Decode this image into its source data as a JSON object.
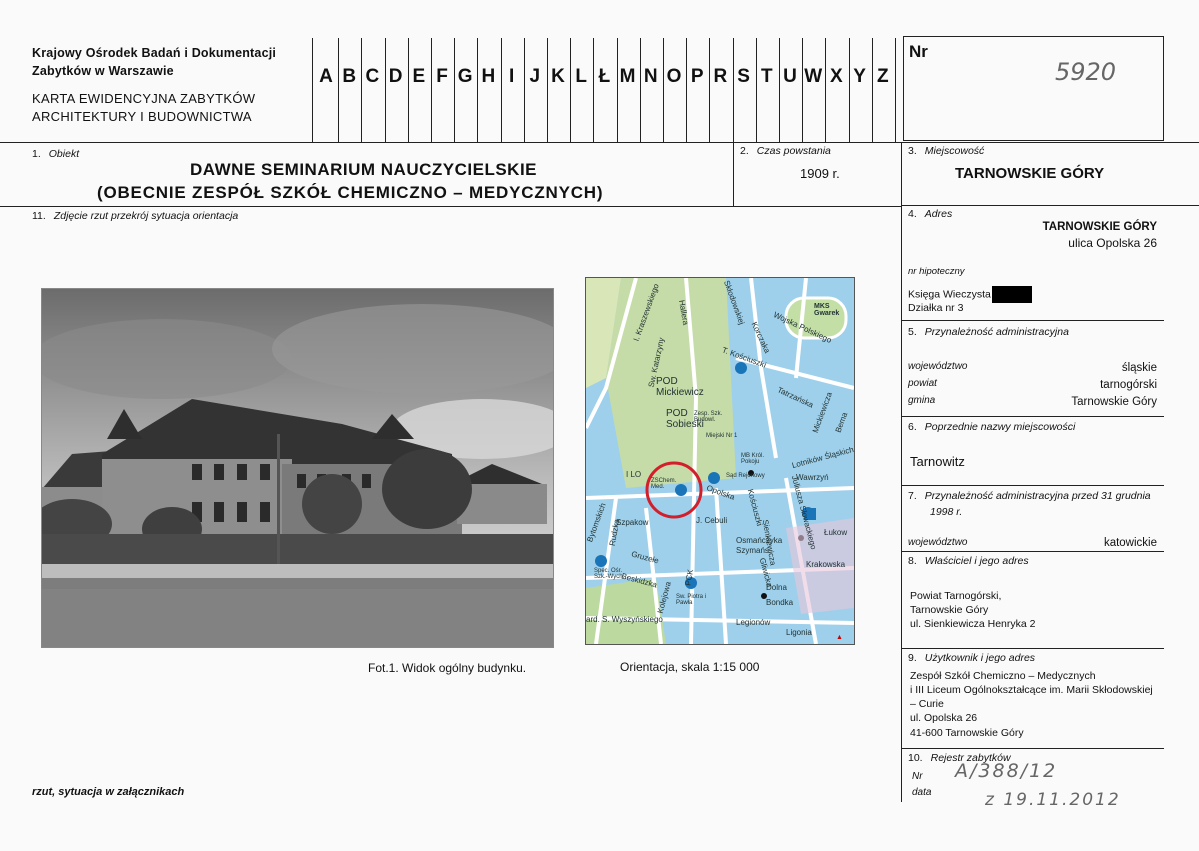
{
  "header": {
    "org_line1": "Krajowy Ośrodek Badań i Dokumentacji",
    "org_line2": "Zabytków w Warszawie",
    "card_line1": "KARTA EWIDENCYJNA ZABYTKÓW",
    "card_line2": "ARCHITEKTURY I BUDOWNICTWA",
    "letters": [
      "A",
      "B",
      "C",
      "D",
      "E",
      "F",
      "G",
      "H",
      "I",
      "J",
      "K",
      "L",
      "Ł",
      "M",
      "N",
      "O",
      "P",
      "R",
      "S",
      "T",
      "U",
      "W",
      "X",
      "Y",
      "Z"
    ],
    "nr_label": "Nr",
    "nr_value": "5920"
  },
  "object": {
    "label_num": "1.",
    "label": "Obiekt",
    "title1": "DAWNE SEMINARIUM NAUCZYCIELSKIE",
    "title2": "(OBECNIE ZESPÓŁ SZKÓŁ CHEMICZNO – MEDYCZNYCH)"
  },
  "period": {
    "label_num": "2.",
    "label": "Czas powstania",
    "value": "1909 r."
  },
  "locality": {
    "label_num": "3.",
    "label": "Miejscowość",
    "value": "TARNOWSKIE GÓRY"
  },
  "photos_label": {
    "num": "11.",
    "text": "Zdjęcie rzut przekrój sytuacja orientacja"
  },
  "address": {
    "label_num": "4.",
    "label": "Adres",
    "city": "TARNOWSKIE GÓRY",
    "street": "ulica Opolska 26",
    "mortgage_label": "nr hipoteczny",
    "land_register": "Księga Wieczysta",
    "plot": "Działka nr 3"
  },
  "admin": {
    "label_num": "5.",
    "label": "Przynależność administracyjna",
    "rows": [
      {
        "key": "województwo",
        "value": "śląskie"
      },
      {
        "key": "powiat",
        "value": "tarnogórski"
      },
      {
        "key": "gmina",
        "value": "Tarnowskie Góry"
      }
    ]
  },
  "former_names": {
    "label_num": "6.",
    "label": "Poprzednie nazwy miejscowości",
    "value": "Tarnowitz"
  },
  "admin_before": {
    "label_num": "7.",
    "label1": "Przynależność administracyjna przed 31 grudnia",
    "label2": "1998 r.",
    "key": "województwo",
    "value": "katowickie"
  },
  "owner": {
    "label_num": "8.",
    "label": "Właściciel i jego adres",
    "lines": [
      "Powiat Tarnogórski,",
      "Tarnowskie Góry",
      "ul. Sienkiewicza Henryka 2"
    ]
  },
  "user": {
    "label_num": "9.",
    "label": "Użytkownik  i jego adres",
    "lines": [
      "Zespół Szkół Chemiczno – Medycznych",
      "i III Liceum Ogólnokształcące im. Marii Skłodowskiej",
      "– Curie",
      "ul. Opolska 26",
      "41-600 Tarnowskie Góry"
    ]
  },
  "register": {
    "label_num": "10.",
    "label": "Rejestr zabytków",
    "nr_label": "Nr",
    "nr_value": "A/388/12",
    "date_label": "data",
    "date_value": "z 19.11.2012"
  },
  "captions": {
    "photo": "Fot.1. Widok ogólny budynku.",
    "map": "Orientacja, skala 1:15 000"
  },
  "footer_note": "rzut, sytuacja w załącznikach",
  "map": {
    "labels": [
      "I. Kraszewskiego",
      "Sw. Katarzyny",
      "Hallera",
      "Skłodowskiej",
      "Korczaka",
      "Wojska Polskiego",
      "MKS Gwarek",
      "T. Kościuszki",
      "POD Mickiewicz",
      "POD Sobieski",
      "Zesp. Szk. Budowl.",
      "Miejski Nr 1",
      "MB Król. Pokoju",
      "Sąd Rejonowy",
      "ZSChem. Med.",
      "Opolska",
      "J. Cebuli",
      "Szpakow",
      "Bytomskich",
      "Rudzka",
      "Gruzełe",
      "Beskidzka",
      "Sw. Piotra i Pawła",
      "Spec. Ośr. Szk.-Wych.",
      "PCK",
      "Kolejowa",
      "ard. S. Wyszyńskiego",
      "Legionów",
      "Dolna",
      "Bondka",
      "Osmańczyka",
      "Szymańs",
      "Tatrzańska",
      "Mickiewicza",
      "Bema",
      "Sienkiewicza",
      "Lotników Śląskich",
      "Wawrzyń",
      "Krakowska",
      "Łukow",
      "Ligonia",
      "Kościuszki",
      "I LO",
      "Gliwicka",
      "Juliusza Słowackiego"
    ]
  }
}
